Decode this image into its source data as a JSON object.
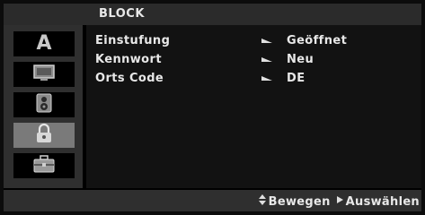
{
  "header": {
    "title": "BLOCK"
  },
  "sidebar": {
    "items": [
      {
        "icon": "language-icon",
        "letter": "A"
      },
      {
        "icon": "display-icon"
      },
      {
        "icon": "audio-icon"
      },
      {
        "icon": "lock-icon",
        "active": true
      },
      {
        "icon": "others-icon"
      }
    ]
  },
  "menu": {
    "rows": [
      {
        "label": "Einstufung",
        "value": "Geöffnet"
      },
      {
        "label": "Kennwort",
        "value": "Neu"
      },
      {
        "label": "Orts Code",
        "value": "DE"
      }
    ]
  },
  "footer": {
    "move_label": "Bewegen",
    "select_label": "Auswählen"
  }
}
